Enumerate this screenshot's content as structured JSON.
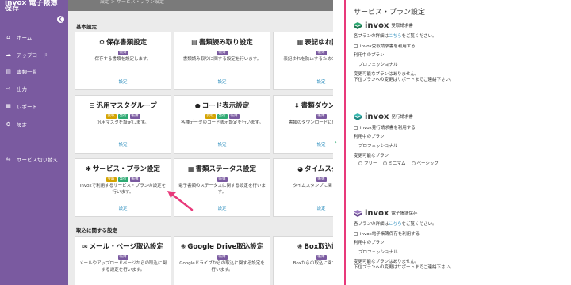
{
  "colors": {
    "brand_purple": "#7a5aa0",
    "accent_pink": "#e8397a",
    "link_blue": "#2e8fbf",
    "tag_green": "#2faa73",
    "tag_yellow": "#d4a300"
  },
  "sidebar": {
    "brand": "invox 電子帳簿保存",
    "items": [
      {
        "label": "ホーム",
        "icon": "home-icon"
      },
      {
        "label": "アップロード",
        "icon": "cloud-upload-icon"
      },
      {
        "label": "書類一覧",
        "icon": "list-icon"
      },
      {
        "label": "出力",
        "icon": "export-icon"
      },
      {
        "label": "レポート",
        "icon": "report-icon"
      },
      {
        "label": "設定",
        "icon": "gear-icon"
      },
      {
        "label": "サービス切り替え",
        "icon": "switch-icon"
      }
    ]
  },
  "main": {
    "header": "設定 > サービス・プラン設定",
    "section_basic": "基本設定",
    "section_import": "取込に関する設定",
    "cards": [
      {
        "title": "保存書類設定",
        "icon": "gear-icon",
        "tags": [
          "帳簿"
        ],
        "desc": "保存する書類を設定します。",
        "link": "設定"
      },
      {
        "title": "書類読み取り設定",
        "icon": "scan-icon",
        "tags": [
          "帳簿"
        ],
        "desc": "書類読み取りに関する設定を行います。",
        "link": "設定"
      },
      {
        "title": "表記ゆれ防止",
        "icon": "chart-icon",
        "tags": [
          "帳簿"
        ],
        "desc": "表記ゆれを防止するための 変換を設定",
        "link": "設定"
      },
      {
        "title": "汎用マスタグループ",
        "icon": "list-icon",
        "tags": [
          "受取",
          "発行",
          "帳簿"
        ],
        "desc": "汎用マスタを設定します。",
        "link": "設定"
      },
      {
        "title": "コード表示設定",
        "icon": "code-icon",
        "tags": [
          "受取",
          "発行",
          "帳簿"
        ],
        "desc": "各種データのコード表示設定を行います。",
        "link": "設定"
      },
      {
        "title": "書類ダウンロー",
        "icon": "download-icon",
        "tags": [
          "帳簿"
        ],
        "desc": "書類のダウンロードに関する設定",
        "link": "設定"
      },
      {
        "title": "サービス・プラン設定",
        "icon": "settings-icon",
        "tags": [
          "受取",
          "発行",
          "帳簿"
        ],
        "desc": "invoxで利用するサービス・プランの設定を行います。",
        "link": "設定"
      },
      {
        "title": "書類ステータス設定",
        "icon": "status-icon",
        "tags": [
          "帳簿"
        ],
        "desc": "電子書類のステータスに関する設定を行います。",
        "link": "設定"
      },
      {
        "title": "タイムスタン",
        "icon": "clock-icon",
        "tags": [
          "帳簿"
        ],
        "desc": "タイムスタンプに関する設定",
        "link": "設定"
      },
      {
        "title": "メール・ページ取込設定",
        "icon": "mail-icon",
        "tags": [
          "帳簿"
        ],
        "desc": "メールやアップロードページからの取込に関する設定を行います。",
        "link": ""
      },
      {
        "title": "Google Drive取込設定",
        "icon": "drive-icon",
        "tags": [
          "帳簿"
        ],
        "desc": "Googleドライブからの取込に関する設定を行います。",
        "link": ""
      },
      {
        "title": "Box取込設定",
        "icon": "box-icon",
        "tags": [
          "帳簿"
        ],
        "desc": "Boxからの取込に関する設定",
        "link": ""
      }
    ]
  },
  "panel": {
    "title": "サービス・プラン設定",
    "products": [
      {
        "name": "invox",
        "sub": "受取請求書",
        "details_prefix": "各プランの詳細は",
        "details_link": "こちら",
        "details_suffix": "をご覧ください。",
        "use_label": "invox受取請求書を利用する",
        "plan_label": "利用中のプラン",
        "plan_value": "プロフェッショナル",
        "change_label": "変更可能なプランはありません。",
        "change_note": "下位プランへの変更はサポートまでご連絡下さい。"
      },
      {
        "name": "invox",
        "sub": "発行請求書",
        "use_label": "invox発行請求書を利用する",
        "plan_label": "利用中のプラン",
        "plan_value": "プロフェッショナル",
        "change_label": "変更可能なプラン",
        "options": [
          "フリー",
          "ミニマム",
          "ベーシック"
        ]
      },
      {
        "name": "invox",
        "sub": "電子帳簿保存",
        "details_prefix": "各プランの詳細は",
        "details_link": "こちら",
        "details_suffix": "をご覧ください。",
        "use_label": "invox電子帳簿保存を利用する",
        "plan_label": "利用中のプラン",
        "plan_value": "プロフェッショナル",
        "change_label": "変更可能なプランはありません。",
        "change_note": "下位プランへの変更はサポートまでご連絡下さい。"
      }
    ]
  }
}
